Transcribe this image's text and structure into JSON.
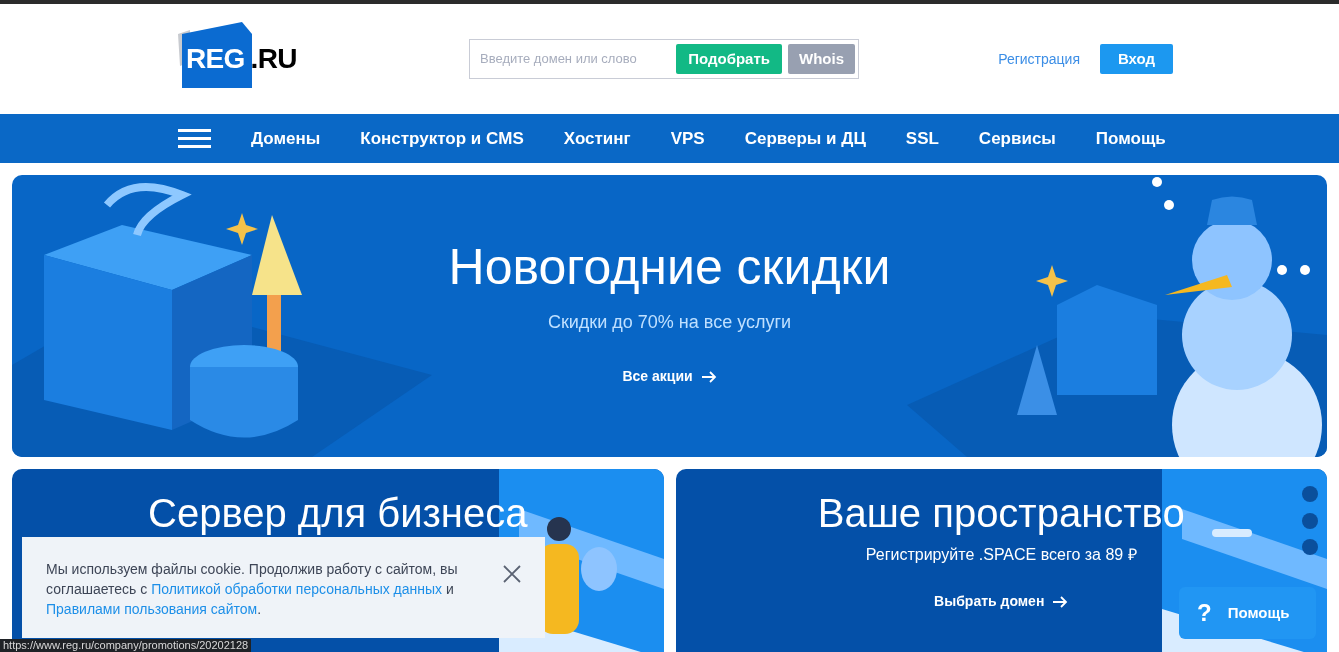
{
  "header": {
    "logo": {
      "main": "REG",
      "suffix": ".RU"
    },
    "search": {
      "placeholder": "Введите домен или слово",
      "pick_button": "Подобрать",
      "whois_button": "Whois"
    },
    "register_link": "Регистрация",
    "login_button": "Вход"
  },
  "nav": {
    "items": [
      "Домены",
      "Конструктор и CMS",
      "Хостинг",
      "VPS",
      "Серверы и ДЦ",
      "SSL",
      "Сервисы",
      "Помощь"
    ]
  },
  "hero": {
    "title": "Новогодние скидки",
    "subtitle": "Скидки до 70% на все услуги",
    "link": "Все акции"
  },
  "cards": [
    {
      "title": "Сервер для бизнеса"
    },
    {
      "title": "Ваше пространство",
      "subtitle": "Регистрируйте .SPACE всего за 89 ₽",
      "link": "Выбрать домен"
    }
  ],
  "cookie_banner": {
    "text": "Мы используем файлы cookie. Продолжив работу с сайтом, вы соглашаетесь с ",
    "link_1": "Политикой обработки персональных данных",
    "joiner": " и ",
    "link_2": "Правилами пользования сайтом",
    "end": "."
  },
  "help_button": {
    "icon": "?",
    "label": "Помощь"
  },
  "status_url": "https://www.reg.ru/company/promotions/20202128"
}
